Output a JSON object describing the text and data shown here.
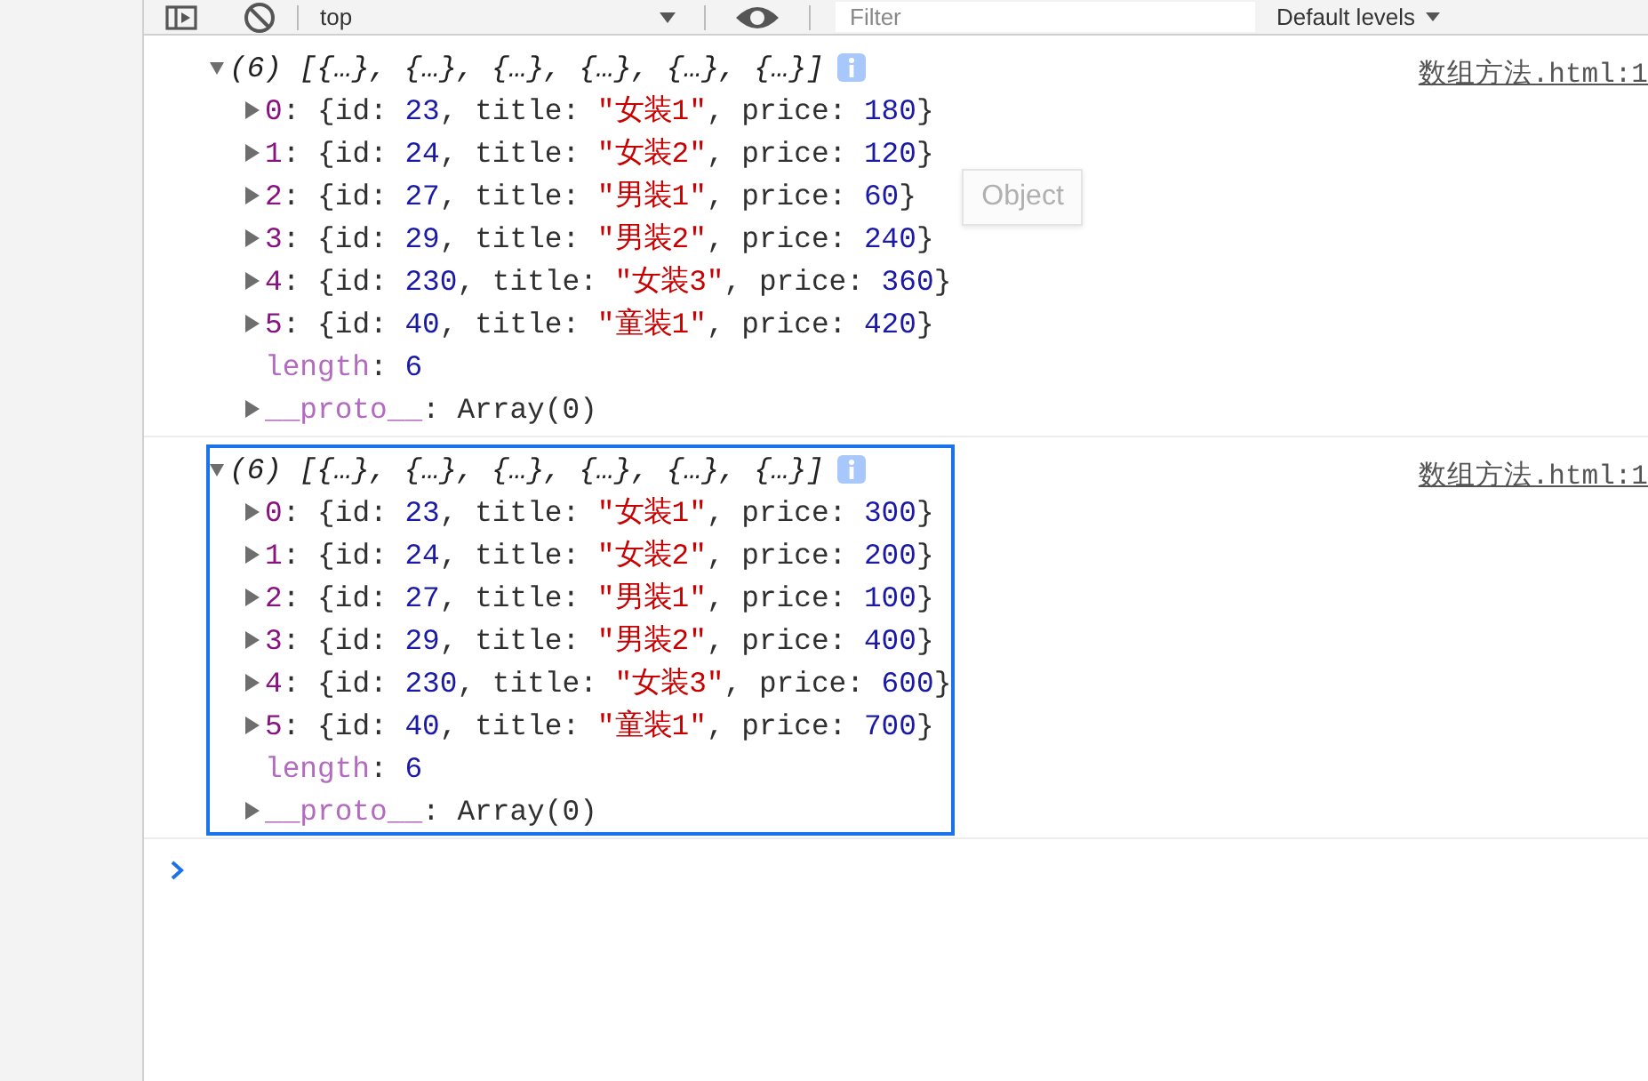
{
  "toolbar": {
    "context": "top",
    "filter_placeholder": "Filter",
    "levels": "Default levels"
  },
  "logs": [
    {
      "header": "(6) [{…}, {…}, {…}, {…}, {…}, {…}]",
      "expanded": true,
      "highlighted": false,
      "source": "数组方法.html:1",
      "rows": [
        {
          "kind": "item",
          "expanded": false,
          "text": "0: {id: 23, title: \"女装1\", price: 180}"
        },
        {
          "kind": "item",
          "expanded": false,
          "text": "1: {id: 24, title: \"女装2\", price: 120}"
        },
        {
          "kind": "item",
          "expanded": false,
          "text": "2: {id: 27, title: \"男装1\", price: 60}",
          "tooltip": "Object"
        },
        {
          "kind": "item",
          "expanded": false,
          "text": "3: {id: 29, title: \"男装2\", price: 240}"
        },
        {
          "kind": "item",
          "expanded": false,
          "text": "4: {id: 230, title: \"女装3\", price: 360}"
        },
        {
          "kind": "item",
          "expanded": false,
          "text": "5: {id: 40, title: \"童装1\", price: 420}"
        },
        {
          "kind": "property",
          "text": "length: 6"
        },
        {
          "kind": "proto",
          "expanded": false,
          "text": "__proto__: Array(0)"
        }
      ]
    },
    {
      "header": "(6) [{…}, {…}, {…}, {…}, {…}, {…}]",
      "expanded": true,
      "highlighted": true,
      "source": "数组方法.html:1",
      "rows": [
        {
          "kind": "item",
          "expanded": false,
          "text": "0: {id: 23, title: \"女装1\", price: 300}"
        },
        {
          "kind": "item",
          "expanded": false,
          "text": "1: {id: 24, title: \"女装2\", price: 200}"
        },
        {
          "kind": "item",
          "expanded": false,
          "text": "2: {id: 27, title: \"男装1\", price: 100}"
        },
        {
          "kind": "item",
          "expanded": false,
          "text": "3: {id: 29, title: \"男装2\", price: 400}"
        },
        {
          "kind": "item",
          "expanded": false,
          "text": "4: {id: 230, title: \"女装3\", price: 600}"
        },
        {
          "kind": "item",
          "expanded": false,
          "text": "5: {id: 40, title: \"童装1\", price: 700}"
        },
        {
          "kind": "property",
          "text": "length: 6"
        },
        {
          "kind": "proto",
          "expanded": false,
          "text": "__proto__: Array(0)"
        }
      ]
    }
  ]
}
